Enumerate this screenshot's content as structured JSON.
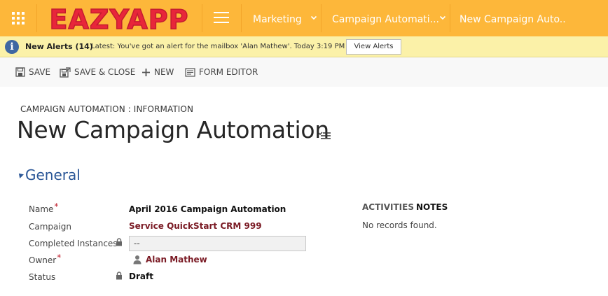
{
  "app": {
    "logo_text": "EAZYAPP",
    "brand_color": "#fdb73a",
    "logo_color": "#e8263a"
  },
  "nav": {
    "items": [
      {
        "label": "Marketing"
      },
      {
        "label": "Campaign Automati..."
      },
      {
        "label": "New Campaign Auto.."
      }
    ]
  },
  "alert": {
    "title": "New Alerts (14)",
    "message": "Latest: You've got an alert for the mailbox 'Alan Mathew'. Today 3:19 PM",
    "button_label": "View Alerts"
  },
  "commands": {
    "save": "SAVE",
    "save_close": "SAVE & CLOSE",
    "new": "NEW",
    "form_editor": "FORM EDITOR"
  },
  "form": {
    "entity_label": "CAMPAIGN AUTOMATION : INFORMATION",
    "title": "New Campaign Automation",
    "section_title": "General",
    "fields": {
      "name": {
        "label": "Name",
        "required": "*",
        "value": "April 2016 Campaign Automation"
      },
      "campaign": {
        "label": "Campaign",
        "value": "Service QuickStart CRM 999"
      },
      "completed": {
        "label": "Completed Instances",
        "value": "--"
      },
      "owner": {
        "label": "Owner",
        "required": "*",
        "value": "Alan Mathew"
      },
      "status": {
        "label": "Status",
        "value": "Draft"
      }
    }
  },
  "social_pane": {
    "tabs": [
      {
        "label": "ACTIVITIES"
      },
      {
        "label": "NOTES"
      }
    ],
    "empty_text": "No records found."
  }
}
